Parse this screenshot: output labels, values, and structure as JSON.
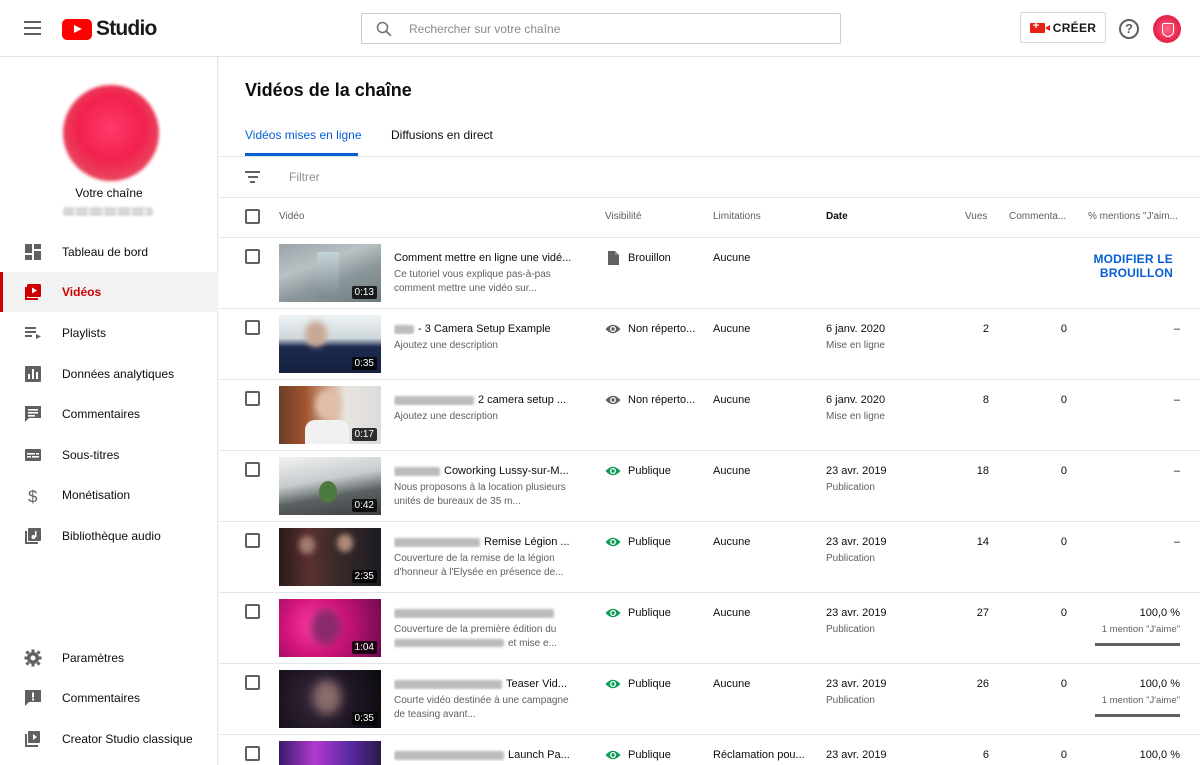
{
  "app": {
    "logo_text": "Studio"
  },
  "search": {
    "placeholder": "Rechercher sur votre chaîne"
  },
  "header": {
    "create_label": "CRÉER",
    "help_symbol": "?"
  },
  "colors": {
    "accent_red": "#cc0000",
    "link_blue": "#065fd4",
    "public_green": "#0f9d58"
  },
  "sidebar": {
    "channel_label": "Votre chaîne",
    "items": [
      {
        "label": "Tableau de bord",
        "icon": "dashboard-icon"
      },
      {
        "label": "Vidéos",
        "icon": "videos-icon",
        "active": true
      },
      {
        "label": "Playlists",
        "icon": "playlist-icon"
      },
      {
        "label": "Données analytiques",
        "icon": "analytics-icon"
      },
      {
        "label": "Commentaires",
        "icon": "comments-icon"
      },
      {
        "label": "Sous-titres",
        "icon": "subtitles-icon"
      },
      {
        "label": "Monétisation",
        "icon": "dollar-icon"
      },
      {
        "label": "Bibliothèque audio",
        "icon": "audio-library-icon"
      }
    ],
    "bottom_items": [
      {
        "label": "Paramètres",
        "icon": "gear-icon"
      },
      {
        "label": "Commentaires",
        "icon": "feedback-icon"
      },
      {
        "label": "Creator Studio classique",
        "icon": "classic-studio-icon"
      }
    ]
  },
  "main": {
    "title": "Vidéos de la chaîne",
    "tabs": [
      {
        "label": "Vidéos mises en ligne",
        "active": true
      },
      {
        "label": "Diffusions en direct"
      }
    ],
    "filter_placeholder": "Filtrer",
    "columns": {
      "video": "Vidéo",
      "visibility": "Visibilité",
      "limitations": "Limitations",
      "date": "Date",
      "views": "Vues",
      "comments": "Commenta...",
      "likes": "% mentions \"J'aim..."
    },
    "rows": [
      {
        "title": "Comment mettre en ligne une vidé...",
        "description": "Ce tutoriel vous explique pas-à-pas comment mettre une vidéo sur...",
        "duration": "0:13",
        "visibility": "Brouillon",
        "visibility_icon": "draft-icon",
        "limitations": "Aucune",
        "action": "MODIFIER LE BROUILLON"
      },
      {
        "title": "- 3 Camera Setup Example",
        "description": "Ajoutez une description",
        "duration": "0:35",
        "visibility": "Non réperto...",
        "visibility_icon": "eye-icon",
        "limitations": "Aucune",
        "date": "6 janv. 2020",
        "date_sub": "Mise en ligne",
        "views": "2",
        "comments": "0",
        "likes": "–"
      },
      {
        "title": "2 camera setup ...",
        "description": "Ajoutez une description",
        "duration": "0:17",
        "visibility": "Non réperto...",
        "visibility_icon": "eye-icon",
        "limitations": "Aucune",
        "date": "6 janv. 2020",
        "date_sub": "Mise en ligne",
        "views": "8",
        "comments": "0",
        "likes": "–"
      },
      {
        "title": "Coworking Lussy-sur-M...",
        "description": "Nous proposons à la location plusieurs unités de bureaux de 35 m...",
        "duration": "0:42",
        "visibility": "Publique",
        "visibility_icon": "eye-public-icon",
        "limitations": "Aucune",
        "date": "23 avr. 2019",
        "date_sub": "Publication",
        "views": "18",
        "comments": "0",
        "likes": "–"
      },
      {
        "title": "Remise Légion ...",
        "description": "Couverture de la remise de la légion d'honneur à l'Elysée en présence de...",
        "duration": "2:35",
        "visibility": "Publique",
        "visibility_icon": "eye-public-icon",
        "limitations": "Aucune",
        "date": "23 avr. 2019",
        "date_sub": "Publication",
        "views": "14",
        "comments": "0",
        "likes": "–"
      },
      {
        "title": "",
        "description": "Couverture de la première édition du",
        "description_2": "et mise e...",
        "duration": "1:04",
        "visibility": "Publique",
        "visibility_icon": "eye-public-icon",
        "limitations": "Aucune",
        "date": "23 avr. 2019",
        "date_sub": "Publication",
        "views": "27",
        "comments": "0",
        "likes": "100,0 %",
        "likes_sub": "1 mention \"J'aime\"",
        "likes_ratio": 1.0
      },
      {
        "title": "Teaser Vid...",
        "description": "Courte vidéo destinée à une campagne de teasing avant...",
        "duration": "0:35",
        "visibility": "Publique",
        "visibility_icon": "eye-public-icon",
        "limitations": "Aucune",
        "date": "23 avr. 2019",
        "date_sub": "Publication",
        "views": "26",
        "comments": "0",
        "likes": "100,0 %",
        "likes_sub": "1 mention \"J'aime\"",
        "likes_ratio": 1.0
      },
      {
        "title": "Launch Pa...",
        "description": "",
        "duration": "",
        "visibility": "Publique",
        "visibility_icon": "eye-public-icon",
        "limitations": "Réclamation pou...",
        "date": "23 avr. 2019",
        "views": "6",
        "comments": "0",
        "likes": "100,0 %"
      }
    ]
  }
}
